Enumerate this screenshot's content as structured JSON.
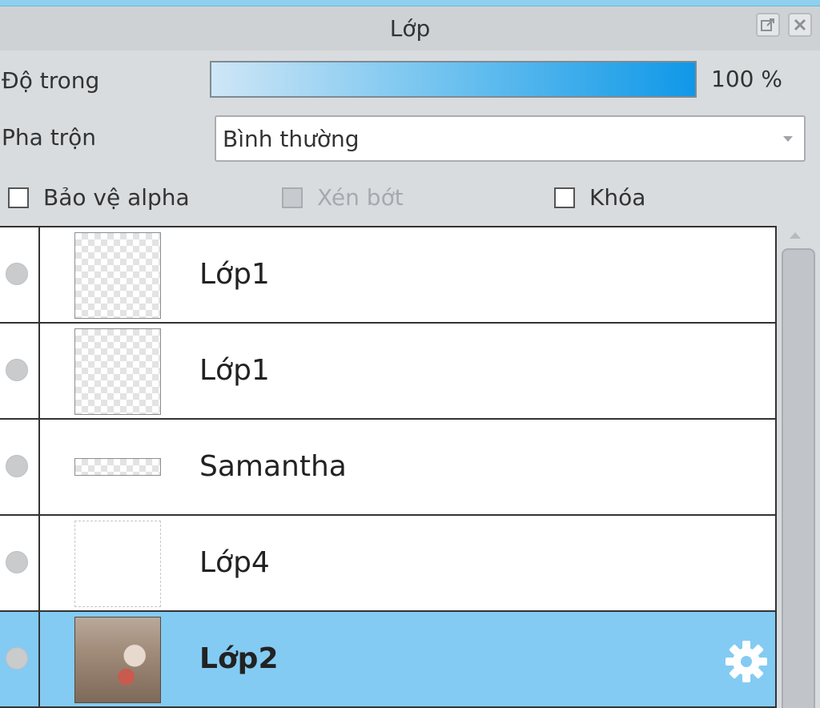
{
  "panel": {
    "title": "Lớp",
    "popout_icon": "popout-icon",
    "close_icon": "close-icon"
  },
  "opacity": {
    "label": "Độ trong",
    "value": 100,
    "display": "100 %"
  },
  "blend": {
    "label": "Pha trộn",
    "selected": "Bình thường"
  },
  "options": {
    "protect_alpha": {
      "label": "Bảo vệ alpha",
      "checked": false,
      "enabled": true
    },
    "clip": {
      "label": "Xén bớt",
      "checked": false,
      "enabled": false
    },
    "lock": {
      "label": "Khóa",
      "checked": false,
      "enabled": true
    }
  },
  "layers": [
    {
      "name": "Lớp1",
      "selected": false,
      "thumbnail": "transparent"
    },
    {
      "name": "Lớp1",
      "selected": false,
      "thumbnail": "transparent"
    },
    {
      "name": "Samantha",
      "selected": false,
      "thumbnail": "text-strip"
    },
    {
      "name": "Lớp4",
      "selected": false,
      "thumbnail": "white"
    },
    {
      "name": "Lớp2",
      "selected": true,
      "thumbnail": "photo",
      "settings_icon": "gear-icon"
    }
  ],
  "colors": {
    "selected_row": "#83cbf3",
    "opacity_fill": "#0f98e8"
  }
}
